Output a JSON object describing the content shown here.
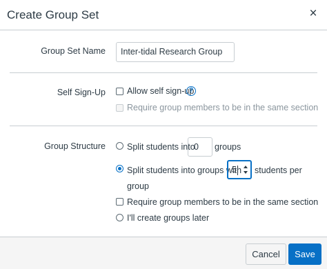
{
  "dialog": {
    "title": "Create Group Set",
    "close_glyph": "×",
    "close_icon": "close-icon"
  },
  "group_set_name": {
    "label": "Group Set Name",
    "value": "Inter-tidal Research Group"
  },
  "self_signup": {
    "label": "Self Sign-Up",
    "allow_label": "Allow self sign-up",
    "allow_checked": false,
    "help_glyph": "?",
    "help_icon": "help-circle-icon",
    "require_section_label": "Require group members to be in the same section",
    "require_section_checked": false,
    "require_section_disabled": true
  },
  "group_structure": {
    "label": "Group Structure",
    "split_into_label_pre": "Split students into",
    "split_into_value": "0",
    "split_into_label_post": "groups",
    "split_with_label_pre": "Split students into groups with",
    "split_with_value": "5",
    "split_with_label_post": "students per",
    "split_with_label_post2": "group",
    "selected_option": "split_with",
    "require_section_label": "Require group members to be in the same section",
    "require_section_checked": false,
    "manual_label": "I'll create groups later"
  },
  "footer": {
    "cancel_label": "Cancel",
    "save_label": "Save"
  },
  "colors": {
    "accent": "#0770c6",
    "text": "#2d3b45",
    "border": "#c7cdd1",
    "footer_bg": "#f5f5f5"
  }
}
